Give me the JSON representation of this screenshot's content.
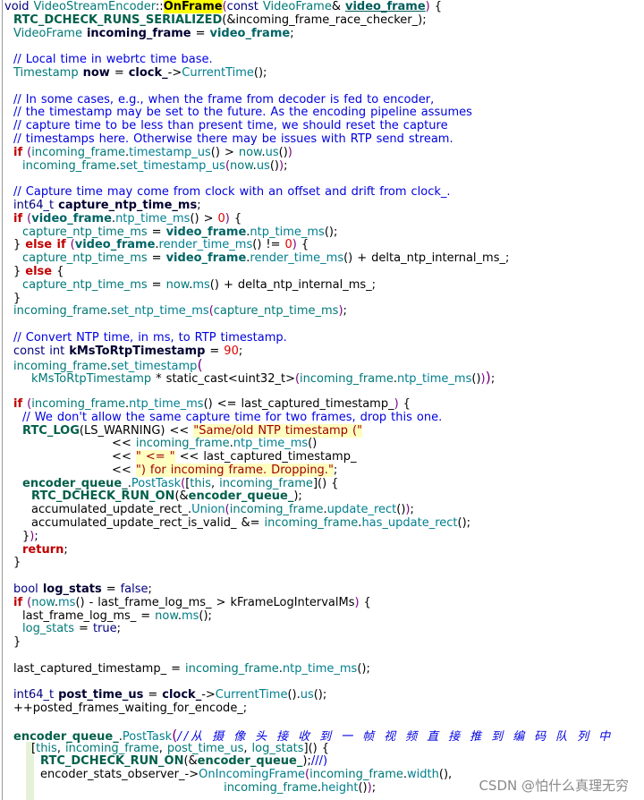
{
  "code": {
    "lines": [
      [
        {
          "kw": "void"
        },
        {
          "p": " "
        },
        {
          "cls": "VideoStreamEncoder"
        },
        {
          "p": "::"
        },
        {
          "hl": "OnFrame"
        },
        {
          "pp": "("
        },
        {
          "kw": "const"
        },
        {
          "p": " "
        },
        {
          "cls": "VideoFrame"
        },
        {
          "p": "& "
        },
        {
          "sig": "video_frame"
        },
        {
          "pp": ")"
        },
        {
          "p": " {"
        }
      ],
      [
        {
          "p": "  "
        },
        {
          "mac": "RTC_DCHECK_RUNS_SERIALIZED"
        },
        {
          "p": "(&incoming_frame_race_checker_);"
        }
      ],
      [
        {
          "p": "  "
        },
        {
          "cls": "VideoFrame"
        },
        {
          "p": " "
        },
        {
          "decl": "incoming_frame"
        },
        {
          "p": " = "
        },
        {
          "par": "video_frame"
        },
        {
          "p": ";"
        }
      ],
      [],
      [
        {
          "p": "  "
        },
        {
          "cmt": "// Local time in webrtc time base."
        }
      ],
      [
        {
          "p": "  "
        },
        {
          "cls": "Timestamp"
        },
        {
          "p": " "
        },
        {
          "decl": "now"
        },
        {
          "p": " = "
        },
        {
          "decl": "clock_"
        },
        {
          "p": "->"
        },
        {
          "fn": "CurrentTime"
        },
        {
          "p": "();"
        }
      ],
      [],
      [
        {
          "p": "  "
        },
        {
          "cmt": "// In some cases, e.g., when the frame from decoder is fed to encoder,"
        }
      ],
      [
        {
          "p": "  "
        },
        {
          "cmt": "// the timestamp may be set to the future. As the encoding pipeline assumes"
        }
      ],
      [
        {
          "p": "  "
        },
        {
          "cmt": "// capture time to be less than present time, we should reset the capture"
        }
      ],
      [
        {
          "p": "  "
        },
        {
          "cmt": "// timestamps here. Otherwise there may be issues with RTP send stream."
        }
      ],
      [
        {
          "p": "  "
        },
        {
          "ctl": "if"
        },
        {
          "p": " "
        },
        {
          "pp": "("
        },
        {
          "var": "incoming_frame"
        },
        {
          "p": "."
        },
        {
          "fn": "timestamp_us"
        },
        {
          "p": "() > "
        },
        {
          "var": "now"
        },
        {
          "p": "."
        },
        {
          "fn": "us"
        },
        {
          "p": "()"
        },
        {
          "pp": ")"
        }
      ],
      [
        {
          "p": "    "
        },
        {
          "var": "incoming_frame"
        },
        {
          "p": "."
        },
        {
          "fn": "set_timestamp_us"
        },
        {
          "pp": "("
        },
        {
          "var": "now"
        },
        {
          "p": "."
        },
        {
          "fn": "us"
        },
        {
          "p": "()"
        },
        {
          "pp": ")"
        },
        {
          "p": ";"
        }
      ],
      [],
      [
        {
          "p": "  "
        },
        {
          "cmt": "// Capture time may come from clock with an offset and drift from clock_."
        }
      ],
      [
        {
          "p": "  "
        },
        {
          "kw": "int64_t"
        },
        {
          "p": " "
        },
        {
          "decl": "capture_ntp_time_ms"
        },
        {
          "p": ";"
        }
      ],
      [
        {
          "p": "  "
        },
        {
          "ctl": "if"
        },
        {
          "p": " "
        },
        {
          "pp": "("
        },
        {
          "par": "video_frame"
        },
        {
          "p": "."
        },
        {
          "fn": "ntp_time_ms"
        },
        {
          "p": "() > "
        },
        {
          "num": "0"
        },
        {
          "pp": ")"
        },
        {
          "p": " {"
        }
      ],
      [
        {
          "p": "    "
        },
        {
          "var": "capture_ntp_time_ms"
        },
        {
          "p": " = "
        },
        {
          "par": "video_frame"
        },
        {
          "p": "."
        },
        {
          "fn": "ntp_time_ms"
        },
        {
          "p": "();"
        }
      ],
      [
        {
          "p": "  } "
        },
        {
          "ctl": "else if"
        },
        {
          "p": " "
        },
        {
          "pp": "("
        },
        {
          "par": "video_frame"
        },
        {
          "p": "."
        },
        {
          "fn": "render_time_ms"
        },
        {
          "p": "() != "
        },
        {
          "num": "0"
        },
        {
          "pp": ")"
        },
        {
          "p": " {"
        }
      ],
      [
        {
          "p": "    "
        },
        {
          "var": "capture_ntp_time_ms"
        },
        {
          "p": " = "
        },
        {
          "par": "video_frame"
        },
        {
          "p": "."
        },
        {
          "fn": "render_time_ms"
        },
        {
          "p": "() + delta_ntp_internal_ms_;"
        }
      ],
      [
        {
          "p": "  } "
        },
        {
          "ctl": "else"
        },
        {
          "p": " {"
        }
      ],
      [
        {
          "p": "    "
        },
        {
          "var": "capture_ntp_time_ms"
        },
        {
          "p": " = "
        },
        {
          "var": "now"
        },
        {
          "p": "."
        },
        {
          "fn": "ms"
        },
        {
          "p": "() + delta_ntp_internal_ms_;"
        }
      ],
      [
        {
          "p": "  }"
        }
      ],
      [
        {
          "p": "  "
        },
        {
          "var": "incoming_frame"
        },
        {
          "p": "."
        },
        {
          "fn": "set_ntp_time_ms"
        },
        {
          "pp": "("
        },
        {
          "var": "capture_ntp_time_ms"
        },
        {
          "pp": ")"
        },
        {
          "p": ";"
        }
      ],
      [],
      [
        {
          "p": "  "
        },
        {
          "cmt": "// Convert NTP time, in ms, to RTP timestamp."
        }
      ],
      [
        {
          "p": "  "
        },
        {
          "kw": "const int"
        },
        {
          "p": " "
        },
        {
          "decl": "kMsToRtpTimestamp"
        },
        {
          "p": " = "
        },
        {
          "num": "90"
        },
        {
          "p": ";"
        }
      ],
      [
        {
          "p": "  "
        },
        {
          "var": "incoming_frame"
        },
        {
          "p": "."
        },
        {
          "fn": "set_timestamp"
        },
        {
          "ppb": "("
        }
      ],
      [
        {
          "p": "      "
        },
        {
          "var": "kMsToRtpTimestamp"
        },
        {
          "p": " * static_cast<uint32_t>"
        },
        {
          "pp": "("
        },
        {
          "var": "incoming_frame"
        },
        {
          "p": "."
        },
        {
          "fn": "ntp_time_ms"
        },
        {
          "p": "()"
        },
        {
          "pp": ")"
        },
        {
          "ppb": ")"
        },
        {
          "p": ";"
        }
      ],
      [],
      [
        {
          "p": "  "
        },
        {
          "ctl": "if"
        },
        {
          "p": " "
        },
        {
          "pp": "("
        },
        {
          "var": "incoming_frame"
        },
        {
          "p": "."
        },
        {
          "fn": "ntp_time_ms"
        },
        {
          "p": "() <= last_captured_timestamp_"
        },
        {
          "pp": ")"
        },
        {
          "p": " {"
        }
      ],
      [
        {
          "p": "    "
        },
        {
          "cmt": "// We don't allow the same capture time for two frames, drop this one."
        }
      ],
      [
        {
          "p": "    "
        },
        {
          "mac": "RTC_LOG"
        },
        {
          "p": "(LS_WARNING) << "
        },
        {
          "str": "\"Same/old NTP timestamp (\""
        }
      ],
      [
        {
          "p": "                        << "
        },
        {
          "var": "incoming_frame"
        },
        {
          "p": "."
        },
        {
          "fn": "ntp_time_ms"
        },
        {
          "p": "()"
        }
      ],
      [
        {
          "p": "                        << "
        },
        {
          "str": "\" <= \""
        },
        {
          "p": " << last_captured_timestamp_"
        }
      ],
      [
        {
          "p": "                        << "
        },
        {
          "str": "\") for incoming frame. Dropping.\""
        },
        {
          "p": ";"
        }
      ],
      [
        {
          "p": "    "
        },
        {
          "mem": "encoder_queue_"
        },
        {
          "p": "."
        },
        {
          "fn": "PostTask"
        },
        {
          "pp": "("
        },
        {
          "p": "["
        },
        {
          "var": "this"
        },
        {
          "p": ", "
        },
        {
          "var": "incoming_frame"
        },
        {
          "p": "]() {"
        }
      ],
      [
        {
          "p": "      "
        },
        {
          "mac": "RTC_DCHECK_RUN_ON"
        },
        {
          "p": "(&"
        },
        {
          "mem": "encoder_queue_"
        },
        {
          "p": ");"
        }
      ],
      [
        {
          "p": "      accumulated_update_rect_."
        },
        {
          "fn": "Union"
        },
        {
          "pp": "("
        },
        {
          "var": "incoming_frame"
        },
        {
          "p": "."
        },
        {
          "fn": "update_rect"
        },
        {
          "p": "()"
        },
        {
          "pp": ")"
        },
        {
          "p": ";"
        }
      ],
      [
        {
          "p": "      accumulated_update_rect_is_valid_ &= "
        },
        {
          "var": "incoming_frame"
        },
        {
          "p": "."
        },
        {
          "fn": "has_update_rect"
        },
        {
          "p": "();"
        }
      ],
      [
        {
          "p": "    }"
        },
        {
          "pp": ")"
        },
        {
          "p": ";"
        }
      ],
      [
        {
          "p": "    "
        },
        {
          "ctl": "return"
        },
        {
          "p": ";"
        }
      ],
      [
        {
          "p": "  }"
        }
      ],
      [],
      [
        {
          "p": "  "
        },
        {
          "kw": "bool"
        },
        {
          "p": " "
        },
        {
          "decl": "log_stats"
        },
        {
          "p": " = "
        },
        {
          "kw": "false"
        },
        {
          "p": ";"
        }
      ],
      [
        {
          "p": "  "
        },
        {
          "ctl": "if"
        },
        {
          "p": " "
        },
        {
          "pp": "("
        },
        {
          "var": "now"
        },
        {
          "p": "."
        },
        {
          "fn": "ms"
        },
        {
          "p": "() - last_frame_log_ms_ > kFrameLogIntervalMs"
        },
        {
          "pp": ")"
        },
        {
          "p": " {"
        }
      ],
      [
        {
          "p": "    last_frame_log_ms_ = "
        },
        {
          "var": "now"
        },
        {
          "p": "."
        },
        {
          "fn": "ms"
        },
        {
          "p": "();"
        }
      ],
      [
        {
          "p": "    "
        },
        {
          "var": "log_stats"
        },
        {
          "p": " = "
        },
        {
          "kw": "true"
        },
        {
          "p": ";"
        }
      ],
      [
        {
          "p": "  }"
        }
      ],
      [],
      [
        {
          "p": "  last_captured_timestamp_ = "
        },
        {
          "var": "incoming_frame"
        },
        {
          "p": "."
        },
        {
          "fn": "ntp_time_ms"
        },
        {
          "p": "();"
        }
      ],
      [],
      [
        {
          "p": "  "
        },
        {
          "kw": "int64_t"
        },
        {
          "p": " "
        },
        {
          "decl": "post_time_us"
        },
        {
          "p": " = "
        },
        {
          "decl": "clock_"
        },
        {
          "p": "->"
        },
        {
          "fn": "CurrentTime"
        },
        {
          "p": "()."
        },
        {
          "fn": "us"
        },
        {
          "p": "();"
        }
      ],
      [
        {
          "p": "  ++posted_frames_waiting_for_encode_;"
        }
      ],
      [],
      [
        {
          "p": "  "
        },
        {
          "mem": "encoder_queue_"
        },
        {
          "p": "."
        },
        {
          "fn": "PostTask"
        },
        {
          "ppb": "("
        },
        {
          "cjk": "//从 摄 像 头 接 收 到 一 帧 视 频 直 接 推 到 编 码 队 列 中"
        }
      ],
      [
        {
          "p": "      ["
        },
        {
          "var": "this"
        },
        {
          "p": ", "
        },
        {
          "var": "incoming_frame"
        },
        {
          "p": ", "
        },
        {
          "var": "post_time_us"
        },
        {
          "p": ", "
        },
        {
          "var": "log_stats"
        },
        {
          "p": "]() {"
        }
      ],
      [
        {
          "p": "        "
        },
        {
          "mac": "RTC_DCHECK_RUN_ON"
        },
        {
          "p": "(&"
        },
        {
          "mem": "encoder_queue_"
        },
        {
          "p": ");"
        },
        {
          "cmt": "///)"
        }
      ],
      [
        {
          "p": "        encoder_stats_observer_->"
        },
        {
          "fn": "OnIncomingFrame"
        },
        {
          "pp": "("
        },
        {
          "var": "incoming_frame"
        },
        {
          "p": "."
        },
        {
          "fn": "width"
        },
        {
          "p": "(),"
        }
      ],
      [
        {
          "p": "                                                 "
        },
        {
          "var": "incoming_frame"
        },
        {
          "p": "."
        },
        {
          "fn": "height"
        },
        {
          "p": "()"
        },
        {
          "pp": ")"
        },
        {
          "p": ";"
        }
      ]
    ]
  },
  "colors": {
    "p": "#000000",
    "kw": "#00007f",
    "ctl": "#c00000",
    "cmt": "#0000e0",
    "cjk": "#0000e0",
    "var": "#007878",
    "decl": "#000030",
    "par": "#006464",
    "sig": "#005c5c",
    "fn": "#007f8f",
    "mac": "#005f4a",
    "mem": "#005f4a",
    "cls": "#007878",
    "num": "#e00000",
    "str": "#a00000",
    "hl": "#000000",
    "pp": "#7a0080",
    "ppb": "#7a0080",
    "string_bg": "#ffffc0",
    "highlight_bg": "#ffff00"
  },
  "watermark": {
    "text": "CSDN @怕什么真理无穷"
  }
}
